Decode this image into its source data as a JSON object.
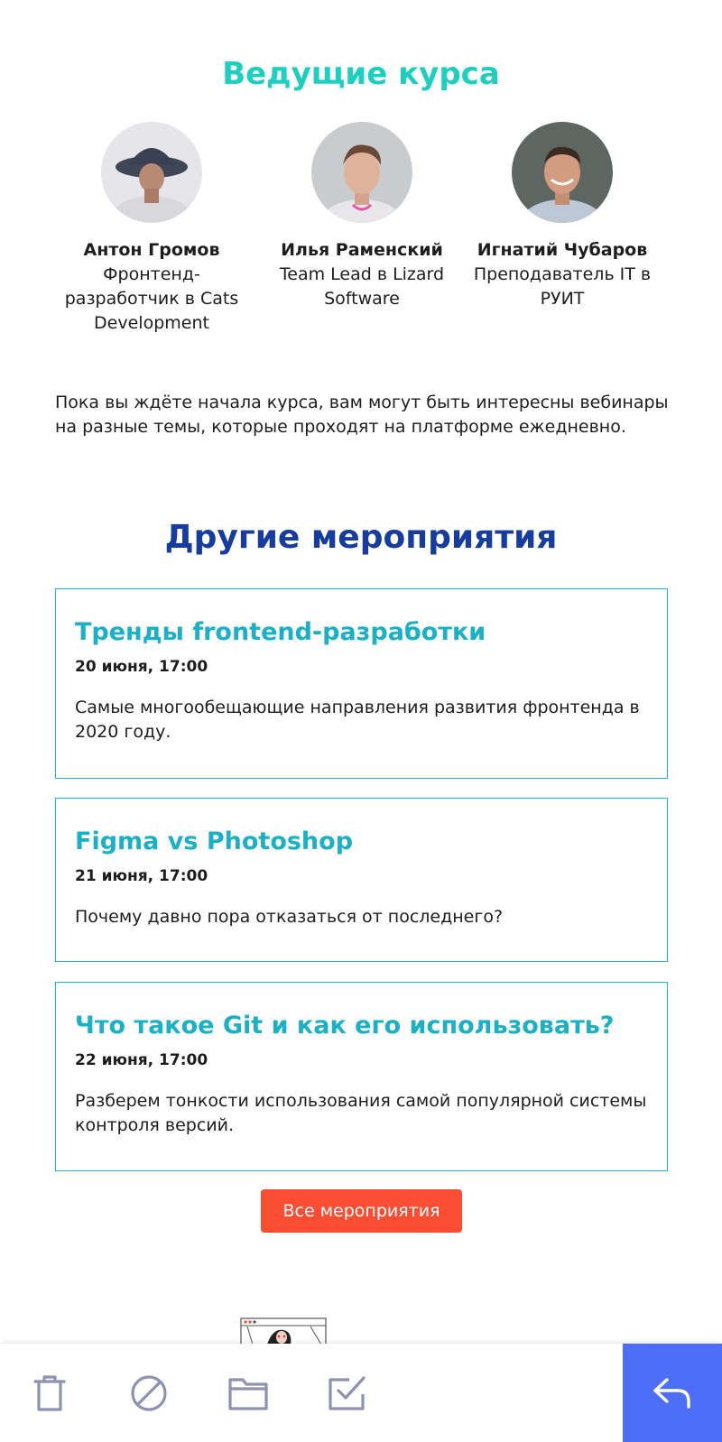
{
  "hosts": {
    "title": "Ведущие курса",
    "people": [
      {
        "name": "Антон Громов",
        "role": "Фронтенд-разработчик в Cats Development"
      },
      {
        "name": "Илья Раменский",
        "role": "Team Lead в Lizard Software"
      },
      {
        "name": "Игнатий Чубаров",
        "role": "Преподаватель IT в РУИТ"
      }
    ]
  },
  "intro": "Пока вы ждёте начала курса, вам могут быть интересны вебинары на разные темы, которые проходят на платформе ежедневно.",
  "events": {
    "title": "Другие мероприятия",
    "items": [
      {
        "title": "Тренды frontend-разработки",
        "date": "20 июня, 17:00",
        "description": "Самые многообещающие направления развития фронтенда в 2020 году."
      },
      {
        "title": "Figma vs Photoshop",
        "date": "21 июня, 17:00",
        "description": "Почему давно пора отказаться от последнего?"
      },
      {
        "title": "Что такое Git и как его использовать?",
        "date": "22 июня, 17:00",
        "description": "Разберем тонкости использования самой популярной системы контроля версий."
      }
    ],
    "all_button": "Все мероприятия"
  },
  "toolbar": {
    "icons": [
      "trash-icon",
      "block-icon",
      "folder-icon",
      "mark-read-icon",
      "reply-icon"
    ]
  },
  "colors": {
    "hosts_title": "#1ccfbe",
    "events_title": "#153c9e",
    "event_title": "#1ab0c6",
    "button": "#fb4d32",
    "reply": "#4d6ff7",
    "toolbar_icon": "#8d92b3"
  }
}
